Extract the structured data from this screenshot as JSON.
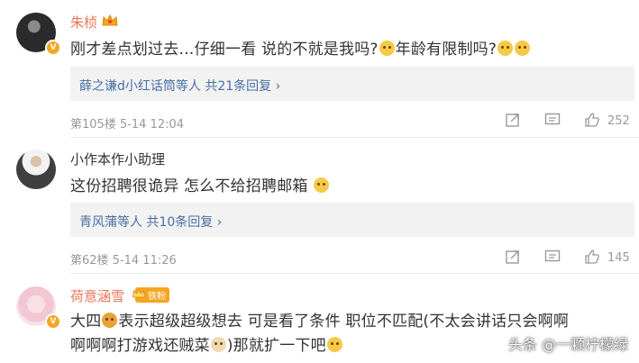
{
  "comments": [
    {
      "name": "朱桢",
      "text_a": "刚才差点划过去…仔细一看 说的不就是我吗?",
      "text_b": "年龄有限制吗?",
      "reply_users": "薛之谦d小红话筒等人",
      "reply_count": "共21条回复",
      "reply_arrow": "›",
      "floor_time": "第105楼 5-14 12:04",
      "likes": "252"
    },
    {
      "name": "小作本作小助理",
      "text_a": "这份招聘很诡异 怎么不给招聘邮箱",
      "reply_users": "青风蒲等人",
      "reply_count": "共10条回复",
      "reply_arrow": "›",
      "floor_time": "第62楼 5-14 11:26",
      "likes": "145"
    },
    {
      "name": "荷意涵雪",
      "badge": "铁粉",
      "text_line1_a": "大四",
      "text_line1_b": "表示超级超级想去 可是看了条件 职位不匹配(不太会讲话只会啊啊",
      "text_line2_a": "啊啊啊打游戏还贼菜",
      "text_line2_b": ")那就扩一下吧"
    }
  ],
  "watermark": "头条 @一颗柠檬绿",
  "colors": {
    "name_orange": "#eb7350",
    "link_blue": "#4a6fa5",
    "meta_gray": "#999999"
  }
}
